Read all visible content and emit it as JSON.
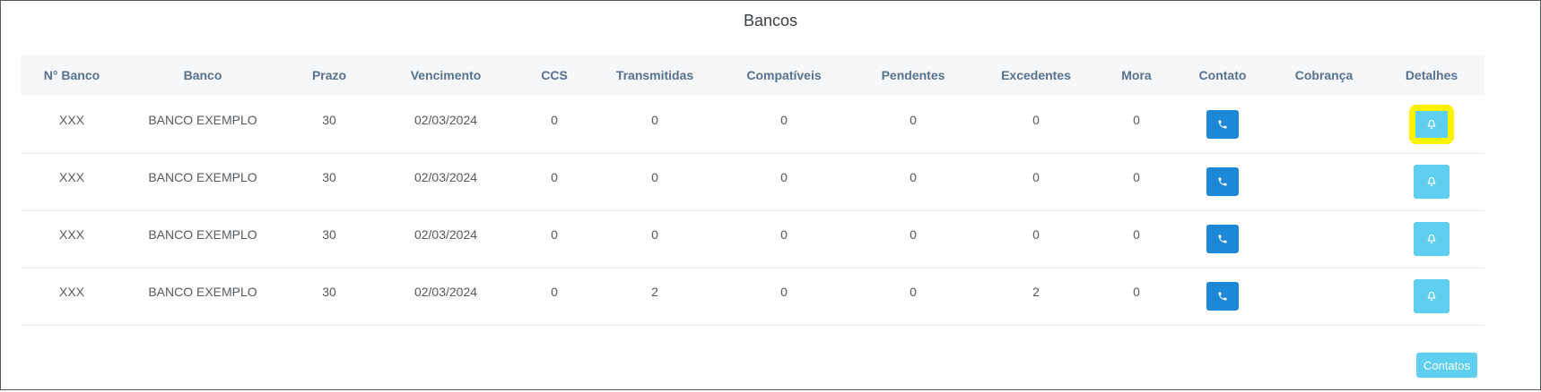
{
  "page": {
    "title": "Bancos"
  },
  "table": {
    "headers": [
      "N° Banco",
      "Banco",
      "Prazo",
      "Vencimento",
      "CCS",
      "Transmitidas",
      "Compatíveis",
      "Pendentes",
      "Excedentes",
      "Mora",
      "Contato",
      "Cobrança",
      "Detalhes"
    ],
    "rows": [
      {
        "numero": "XXX",
        "banco": "BANCO EXEMPLO",
        "prazo": "30",
        "vencimento": "02/03/2024",
        "ccs": "0",
        "transmitidas": "0",
        "compativeis": "0",
        "pendentes": "0",
        "excedentes": "0",
        "mora": "0",
        "cobranca": "",
        "details_highlighted": true
      },
      {
        "numero": "XXX",
        "banco": "BANCO EXEMPLO",
        "prazo": "30",
        "vencimento": "02/03/2024",
        "ccs": "0",
        "transmitidas": "0",
        "compativeis": "0",
        "pendentes": "0",
        "excedentes": "0",
        "mora": "0",
        "cobranca": "",
        "details_highlighted": false
      },
      {
        "numero": "XXX",
        "banco": "BANCO EXEMPLO",
        "prazo": "30",
        "vencimento": "02/03/2024",
        "ccs": "0",
        "transmitidas": "0",
        "compativeis": "0",
        "pendentes": "0",
        "excedentes": "0",
        "mora": "0",
        "cobranca": "",
        "details_highlighted": false
      },
      {
        "numero": "XXX",
        "banco": "BANCO EXEMPLO",
        "prazo": "30",
        "vencimento": "02/03/2024",
        "ccs": "0",
        "transmitidas": "2",
        "compativeis": "0",
        "pendentes": "0",
        "excedentes": "2",
        "mora": "0",
        "cobranca": "",
        "details_highlighted": false
      }
    ]
  },
  "footer": {
    "contatos_label": "Contatos"
  },
  "icons": {
    "contact": "phone-icon",
    "details": "bell-icon"
  },
  "colors": {
    "contact_button": "#1e88d8",
    "details_button": "#5ecfee",
    "highlight": "#fff200",
    "header_text": "#56728e"
  }
}
